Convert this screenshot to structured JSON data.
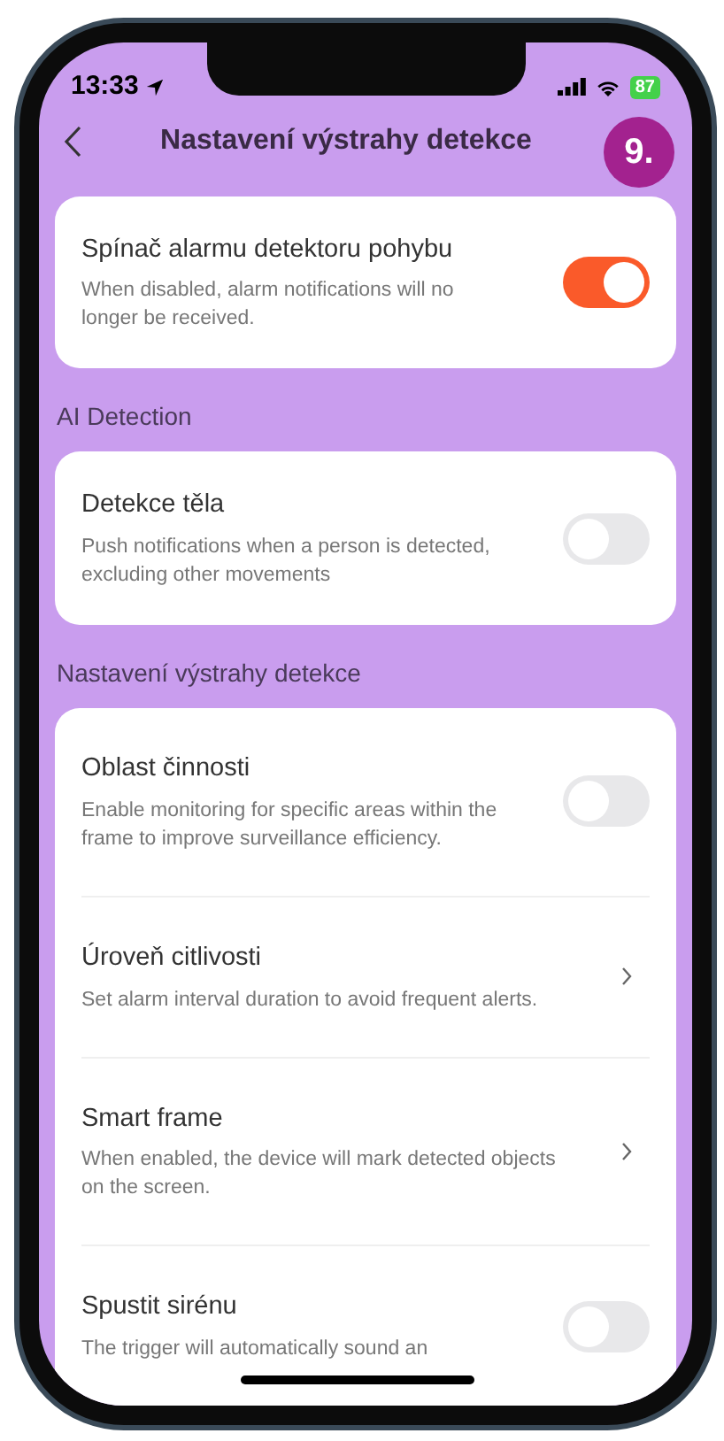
{
  "status_bar": {
    "time": "13:33",
    "battery": "87"
  },
  "nav": {
    "title": "Nastavení výstrahy detekce",
    "badge": "9."
  },
  "sections": [
    {
      "items": [
        {
          "kind": "toggle",
          "title": "Spínač alarmu detektoru pohybu",
          "description": "When disabled, alarm notifications will no longer be received.",
          "on": true
        }
      ]
    },
    {
      "label": "AI Detection",
      "items": [
        {
          "kind": "toggle",
          "title": "Detekce těla",
          "description": "Push notifications when a person is detected, excluding other movements",
          "on": false
        }
      ]
    },
    {
      "label": "Nastavení výstrahy detekce",
      "items": [
        {
          "kind": "toggle",
          "title": "Oblast činnosti",
          "description": "Enable monitoring for specific areas within the frame to improve surveillance efficiency.",
          "on": false
        },
        {
          "kind": "link",
          "title": "Úroveň citlivosti",
          "description": "Set alarm interval duration to avoid frequent alerts."
        },
        {
          "kind": "link",
          "title": "Smart frame",
          "description": "When enabled, the device will mark detected objects on the screen."
        },
        {
          "kind": "toggle",
          "title": "Spustit sirénu",
          "description": "The trigger will automatically sound an",
          "on": false
        }
      ]
    }
  ]
}
